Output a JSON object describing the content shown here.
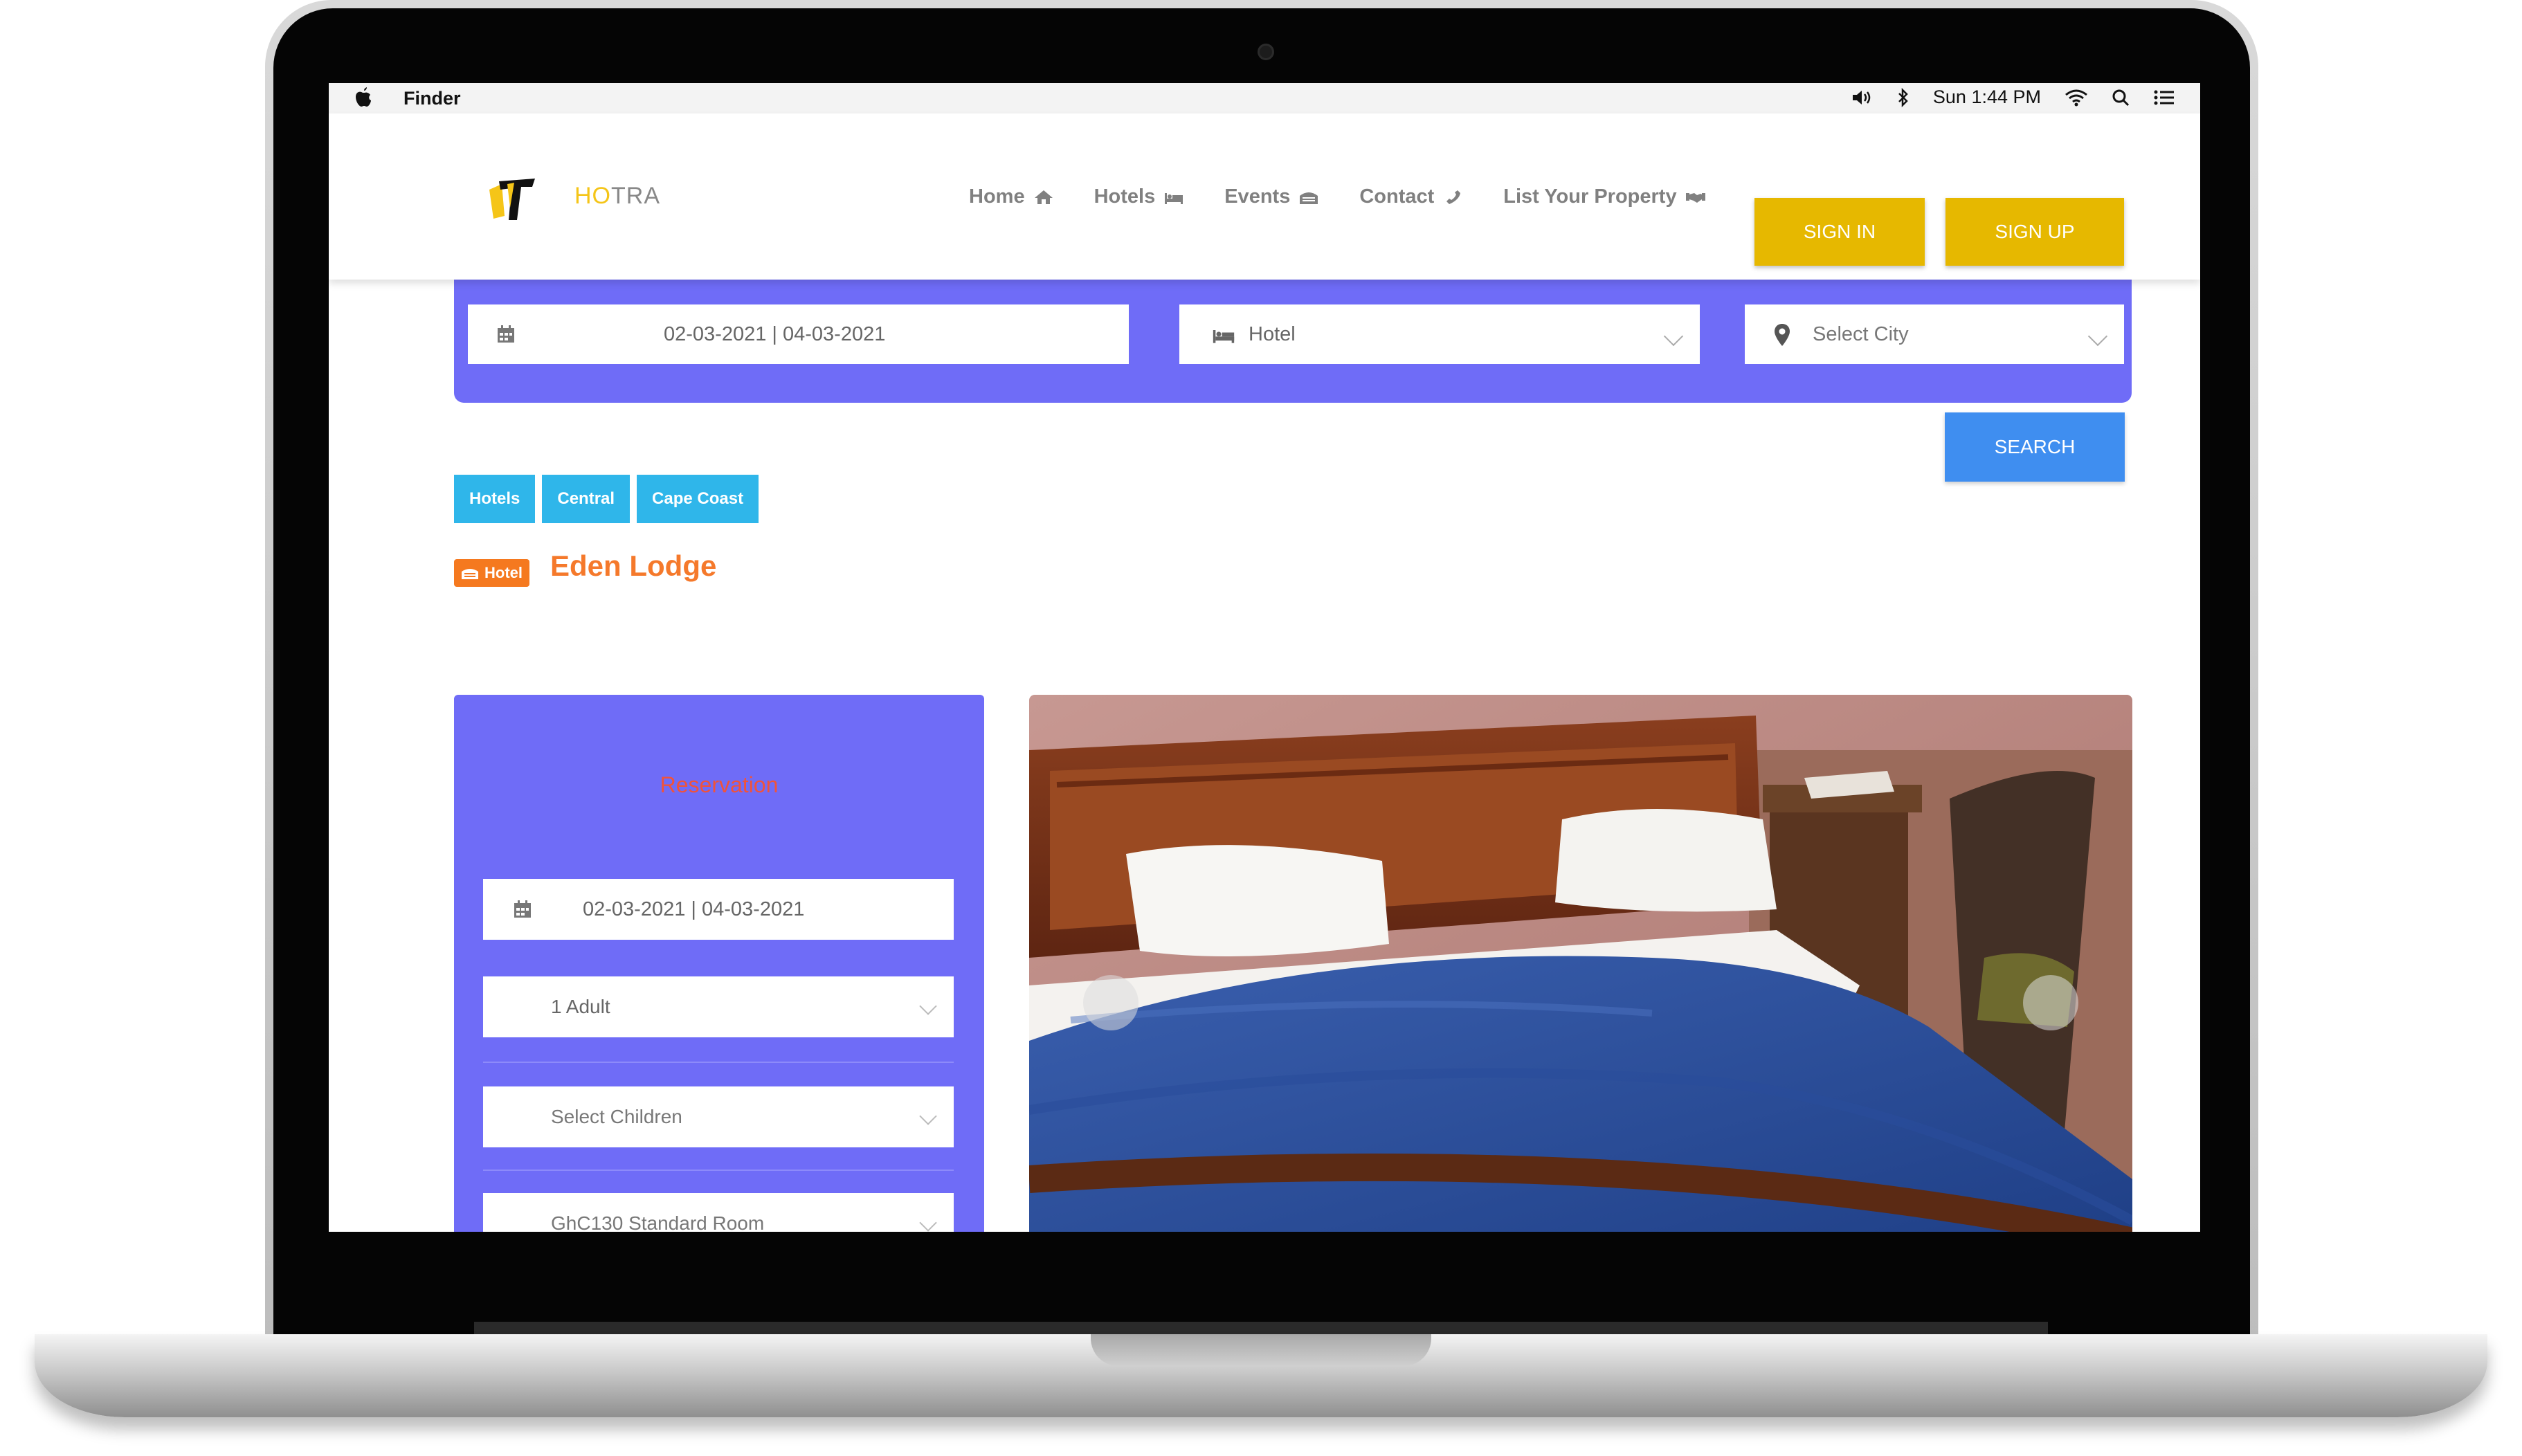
{
  "menubar": {
    "app_name": "Finder",
    "clock": "Sun 1:44 PM",
    "icons": [
      "apple-icon",
      "volume-icon",
      "bluetooth-icon",
      "wifi-icon",
      "spotlight-icon",
      "control-center-icon"
    ]
  },
  "header": {
    "logo_text_highlight": "HO",
    "logo_text_rest": "TRA",
    "nav": [
      {
        "label": "Home",
        "icon": "home-icon"
      },
      {
        "label": "Hotels",
        "icon": "bed-icon"
      },
      {
        "label": "Events",
        "icon": "calendar-icon"
      },
      {
        "label": "Contact",
        "icon": "phone-icon"
      },
      {
        "label": "List Your Property",
        "icon": "handshake-icon"
      }
    ],
    "signin_label": "SIGN IN",
    "signup_label": "SIGN UP",
    "brand_color": "#e6b800"
  },
  "search": {
    "date_range": "02-03-2021 | 04-03-2021",
    "type": "Hotel",
    "city_placeholder": "Select City",
    "search_label": "SEARCH",
    "panel_color": "#6f6cf7"
  },
  "breadcrumb": [
    "Hotels",
    "Central",
    "Cape Coast"
  ],
  "listing": {
    "badge": "Hotel",
    "name": "Eden Lodge"
  },
  "reservation": {
    "title": "Reservation",
    "date_range": "02-03-2021 | 04-03-2021",
    "adults": "1 Adult",
    "children_placeholder": "Select Children",
    "room": "GhC130 Standard Room"
  }
}
